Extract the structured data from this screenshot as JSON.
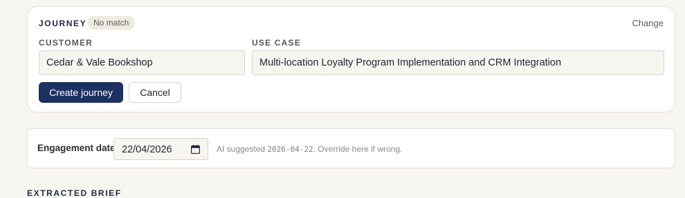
{
  "journey": {
    "title": "JOURNEY",
    "badge": "No match",
    "change_label": "Change",
    "customer_label": "CUSTOMER",
    "customer_value": "Cedar & Vale Bookshop",
    "usecase_label": "USE CASE",
    "usecase_value": "Multi-location Loyalty Program Implementation and CRM Integration",
    "create_label": "Create journey",
    "cancel_label": "Cancel"
  },
  "engagement": {
    "label": "Engagement date",
    "date_value": "22/04/2026",
    "hint_prefix": "AI suggested",
    "hint_date": "2026-04-22",
    "hint_suffix": ". Override here if wrong."
  },
  "extracted_heading": "EXTRACTED BRIEF",
  "colors": {
    "page_bg": "#f7f5f0",
    "primary": "#1c3160",
    "card_border": "#e4e0d6"
  }
}
